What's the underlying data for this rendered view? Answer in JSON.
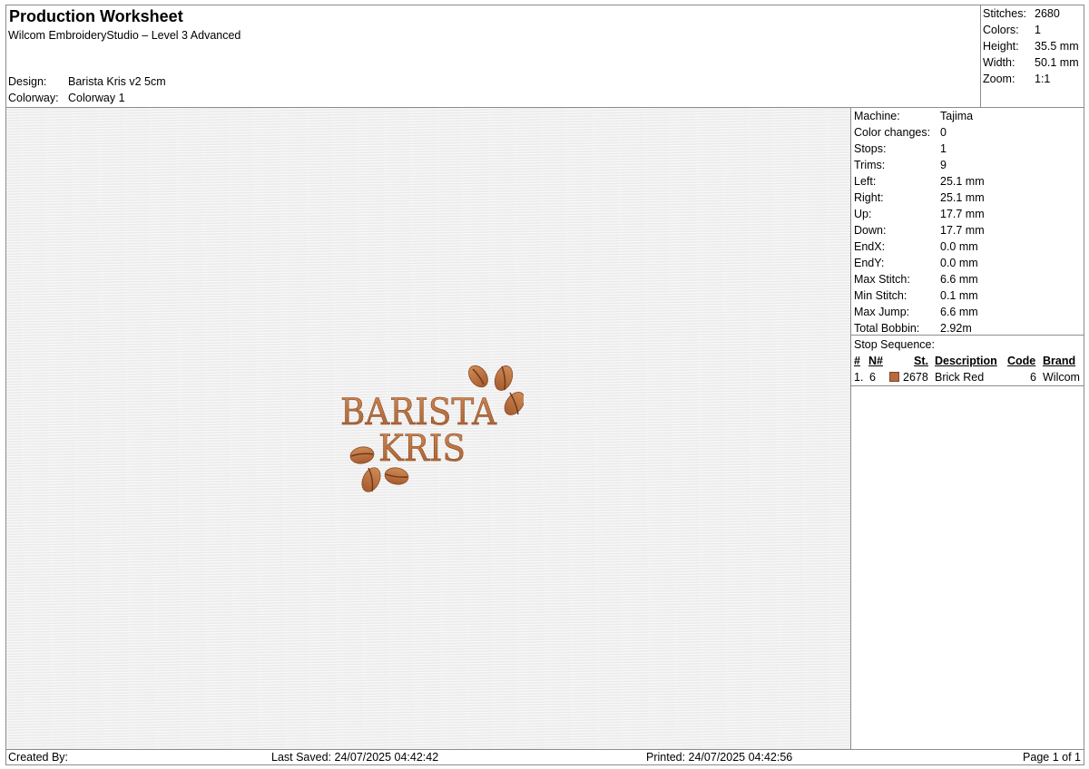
{
  "header": {
    "title": "Production Worksheet",
    "subtitle": "Wilcom EmbroideryStudio – Level 3 Advanced",
    "design_label": "Design:",
    "design_value": "Barista Kris v2 5cm",
    "colorway_label": "Colorway:",
    "colorway_value": "Colorway 1"
  },
  "stats": [
    {
      "label": "Stitches:",
      "value": "2680"
    },
    {
      "label": "Colors:",
      "value": "1"
    },
    {
      "label": "Height:",
      "value": "35.5 mm"
    },
    {
      "label": "Width:",
      "value": "50.1 mm"
    },
    {
      "label": "Zoom:",
      "value": "1:1"
    }
  ],
  "logo": {
    "line1": "BARISTA",
    "line2": "KRIS",
    "thread_color": "#b96a3c"
  },
  "machine": [
    {
      "label": "Machine:",
      "value": "Tajima"
    },
    {
      "label": "Color changes:",
      "value": "0"
    },
    {
      "label": "Stops:",
      "value": "1"
    },
    {
      "label": "Trims:",
      "value": "9"
    },
    {
      "label": "Left:",
      "value": "25.1 mm"
    },
    {
      "label": "Right:",
      "value": "25.1 mm"
    },
    {
      "label": "Up:",
      "value": "17.7 mm"
    },
    {
      "label": "Down:",
      "value": "17.7 mm"
    },
    {
      "label": "EndX:",
      "value": "0.0 mm"
    },
    {
      "label": "EndY:",
      "value": "0.0 mm"
    },
    {
      "label": "Max Stitch:",
      "value": "6.6 mm"
    },
    {
      "label": "Min Stitch:",
      "value": "0.1 mm"
    },
    {
      "label": "Max Jump:",
      "value": "6.6 mm"
    },
    {
      "label": "Total Bobbin:",
      "value": "2.92m"
    }
  ],
  "stop_sequence": {
    "title": "Stop Sequence:",
    "columns": {
      "num": "#",
      "n": "N#",
      "st": "St.",
      "description": "Description",
      "code": "Code",
      "brand": "Brand"
    },
    "rows": [
      {
        "num": "1.",
        "n": "6",
        "color": "#b96a3c",
        "st": "2678",
        "description": "Brick Red",
        "code": "6",
        "brand": "Wilcom"
      }
    ]
  },
  "footer": {
    "created_by": "Created By:",
    "last_saved": "Last Saved: 24/07/2025 04:42:42",
    "printed": "Printed: 24/07/2025 04:42:56",
    "page": "Page 1 of 1"
  }
}
